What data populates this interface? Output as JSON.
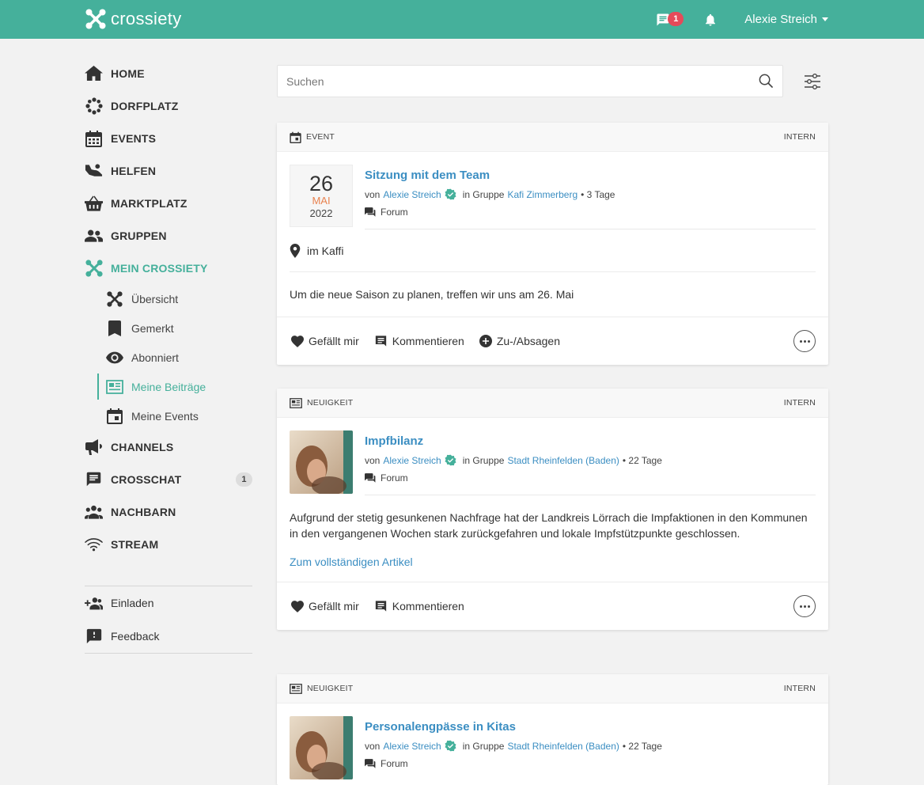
{
  "header": {
    "brand": "crossiety",
    "chat_badge": "1",
    "user_name": "Alexie Streich"
  },
  "sidebar": {
    "items": [
      {
        "label": "HOME",
        "icon": "home-icon"
      },
      {
        "label": "DORFPLATZ",
        "icon": "dorfplatz-icon"
      },
      {
        "label": "EVENTS",
        "icon": "calendar-icon"
      },
      {
        "label": "HELFEN",
        "icon": "helping-hand-icon"
      },
      {
        "label": "MARKTPLATZ",
        "icon": "basket-icon"
      },
      {
        "label": "GRUPPEN",
        "icon": "group-icon"
      },
      {
        "label": "MEIN CROSSIETY",
        "icon": "crossiety-icon"
      }
    ],
    "sub_items": [
      {
        "label": "Übersicht",
        "icon": "crossiety-icon"
      },
      {
        "label": "Gemerkt",
        "icon": "bookmark-icon"
      },
      {
        "label": "Abonniert",
        "icon": "eye-icon"
      },
      {
        "label": "Meine Beiträge",
        "icon": "newspaper-icon"
      },
      {
        "label": "Meine Events",
        "icon": "event-icon"
      }
    ],
    "items2": [
      {
        "label": "CHANNELS",
        "icon": "megaphone-icon"
      },
      {
        "label": "CROSSCHAT",
        "icon": "chat-icon",
        "badge": "1"
      },
      {
        "label": "NACHBARN",
        "icon": "neighbors-icon"
      },
      {
        "label": "STREAM",
        "icon": "stream-icon"
      }
    ],
    "footer": [
      {
        "label": "Einladen",
        "icon": "invite-icon"
      },
      {
        "label": "Feedback",
        "icon": "feedback-icon"
      }
    ]
  },
  "search": {
    "placeholder": "Suchen"
  },
  "colors": {
    "brand": "#45b09b",
    "link": "#3b8ec2",
    "month": "#e8824f",
    "badge": "#e54a5a"
  },
  "posts": [
    {
      "type": "EVENT",
      "visibility": "INTERN",
      "day": "26",
      "month": "MAI",
      "year": "2022",
      "title": "Sitzung mit dem Team",
      "von": "von",
      "author": "Alexie Streich",
      "in_group": "in Gruppe",
      "group": "Kafi Zimmerberg",
      "age": "• 3 Tage",
      "forum": "Forum",
      "location": "im Kaffi",
      "text": "Um die neue Saison zu planen, treffen wir uns am 26. Mai",
      "like": "Gefällt mir",
      "comment": "Kommentieren",
      "attend": "Zu-/Absagen"
    },
    {
      "type": "NEUIGKEIT",
      "visibility": "INTERN",
      "title": "Impfbilanz",
      "von": "von",
      "author": "Alexie Streich",
      "in_group": "in Gruppe",
      "group": "Stadt Rheinfelden (Baden)",
      "age": "• 22 Tage",
      "forum": "Forum",
      "text": "Aufgrund der stetig gesunkenen Nachfrage hat der Landkreis Lörrach die Impfaktionen in den Kommunen in den vergangenen Wochen stark zurückgefahren und lokale Impfstützpunkte geschlossen.",
      "readmore": "Zum vollständigen Artikel",
      "like": "Gefällt mir",
      "comment": "Kommentieren"
    },
    {
      "type": "NEUIGKEIT",
      "visibility": "INTERN",
      "title": "Personalengpässe in Kitas",
      "von": "von",
      "author": "Alexie Streich",
      "in_group": "in Gruppe",
      "group": "Stadt Rheinfelden (Baden)",
      "age": "• 22 Tage",
      "forum": "Forum"
    }
  ]
}
